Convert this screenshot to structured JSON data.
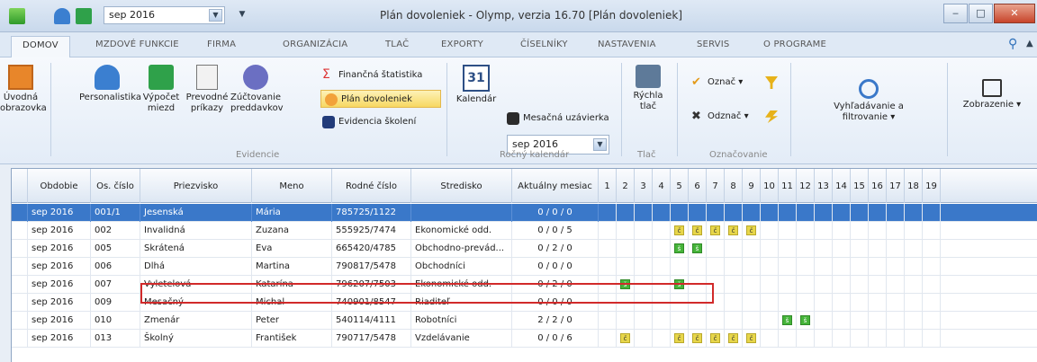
{
  "quick_access": {
    "period": "sep 2016"
  },
  "window": {
    "title": "Plán dovoleniek - Olymp, verzia 16.70 [Plán dovoleniek]",
    "minimize": "‒",
    "maximize": "□",
    "close": "✕"
  },
  "menu_tabs": [
    "DOMOV",
    "MZDOVÉ FUNKCIE",
    "FIRMA",
    "ORGANIZÁCIA",
    "TLAČ",
    "EXPORTY",
    "ČÍSELNÍKY",
    "NASTAVENIA",
    "SERVIS",
    "O PROGRAME"
  ],
  "ribbon": {
    "uvodna": "Úvodná obrazovka",
    "personalistika": "Personalistika",
    "vypocet": "Výpočet miezd",
    "prevodne": "Prevodné príkazy",
    "zuctovanie": "Zúčtovanie preddavkov",
    "financna": "Finančná štatistika",
    "plan": "Plán dovoleniek",
    "evidencia": "Evidencia školení",
    "group_evidencie": "Evidencie",
    "kalendar": "Kalendár",
    "kalendar_day": "31",
    "combo_period": "sep 2016",
    "mesacna": "Mesačná uzávierka",
    "group_rocny": "Ročný kalendár",
    "rychla": "Rýchla tlač",
    "group_tlac": "Tlač",
    "oznac": "Označ ▾",
    "odznac": "Odznač ▾",
    "group_oznacovanie": "Označovanie",
    "vyhladavanie": "Vyhľadávanie a filtrovanie ▾",
    "zobrazenie": "Zobrazenie ▾"
  },
  "grid": {
    "headers": {
      "obdobie": "Obdobie",
      "os_cislo": "Os. číslo",
      "priezvisko": "Priezvisko",
      "meno": "Meno",
      "rodne": "Rodné číslo",
      "stredisko": "Stredisko",
      "aktualny": "Aktuálny mesiac"
    },
    "days": [
      "1",
      "2",
      "3",
      "4",
      "5",
      "6",
      "7",
      "8",
      "9",
      "10",
      "11",
      "12",
      "13",
      "14",
      "15",
      "16",
      "17",
      "18",
      "19"
    ],
    "rows": [
      {
        "obdobie": "sep 2016",
        "os": "001/1",
        "priezvisko": "Jesenská",
        "meno": "Mária",
        "rodne": "785725/1122",
        "stredisko": "",
        "akt": "0 / 0 / 0",
        "marks": {}
      },
      {
        "obdobie": "sep 2016",
        "os": "002",
        "priezvisko": "Invalidná",
        "meno": "Zuzana",
        "rodne": "555925/7474",
        "stredisko": "Ekonomické odd.",
        "akt": "0 / 0 / 5",
        "marks": {
          "5": "c",
          "6": "c",
          "7": "c",
          "8": "c",
          "9": "c"
        }
      },
      {
        "obdobie": "sep 2016",
        "os": "005",
        "priezvisko": "Skrátená",
        "meno": "Eva",
        "rodne": "665420/4785",
        "stredisko": "Obchodno-prevád...",
        "akt": "0 / 2 / 0",
        "marks": {
          "5": "s",
          "6": "s"
        }
      },
      {
        "obdobie": "sep 2016",
        "os": "006",
        "priezvisko": "Dlhá",
        "meno": "Martina",
        "rodne": "790817/5478",
        "stredisko": "Obchodníci",
        "akt": "0 / 0 / 0",
        "marks": {}
      },
      {
        "obdobie": "sep 2016",
        "os": "007",
        "priezvisko": "Vyletelová",
        "meno": "Katarína",
        "rodne": "796207/7503",
        "stredisko": "Ekonomické odd.",
        "akt": "0 / 2 / 0",
        "marks": {
          "2": "s",
          "5": "s"
        }
      },
      {
        "obdobie": "sep 2016",
        "os": "009",
        "priezvisko": "Mesačný",
        "meno": "Michal",
        "rodne": "740901/8547",
        "stredisko": "Riaditeľ",
        "akt": "0 / 0 / 0",
        "marks": {}
      },
      {
        "obdobie": "sep 2016",
        "os": "010",
        "priezvisko": "Zmenár",
        "meno": "Peter",
        "rodne": "540114/4111",
        "stredisko": "Robotníci",
        "akt": "2 / 2 / 0",
        "marks": {
          "11": "s",
          "12": "s"
        }
      },
      {
        "obdobie": "sep 2016",
        "os": "013",
        "priezvisko": "Školný",
        "meno": "František",
        "rodne": "790717/5478",
        "stredisko": "Vzdelávanie",
        "akt": "0 / 0 / 6",
        "marks": {
          "2": "c",
          "5": "c",
          "6": "c",
          "7": "c",
          "8": "c",
          "9": "c"
        }
      }
    ],
    "mark_letters": {
      "c": "č",
      "s": "š"
    }
  },
  "colors": {
    "selected_row": "#3a78c9",
    "mark_c": "#e7d64a",
    "mark_s": "#46b43a",
    "highlight_box": "#d12a2a"
  }
}
